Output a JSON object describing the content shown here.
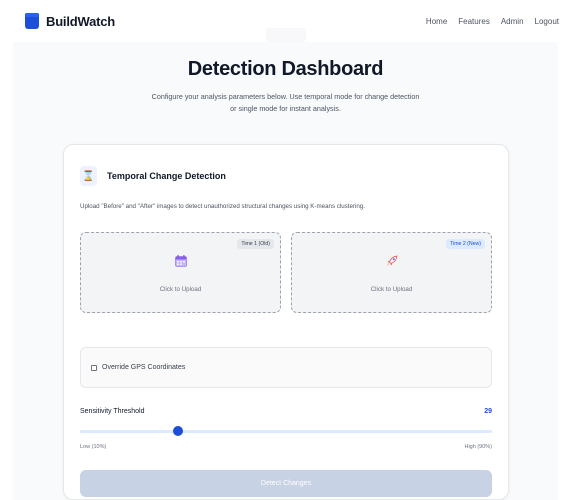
{
  "navbar": {
    "brand": "BuildWatch",
    "links": [
      "Home",
      "Features",
      "Admin",
      "Logout"
    ]
  },
  "hero": {
    "title": "Detection Dashboard",
    "subtitle": "Configure your analysis parameters below. Use temporal mode for change detection or single mode for instant analysis."
  },
  "card": {
    "title": "Temporal Change Detection",
    "description": "Upload \"Before\" and \"After\" images to detect unauthorized structural changes using K-means clustering.",
    "uploads": [
      {
        "tag": "Time 1 (Old)",
        "label": "Click to Upload",
        "icon": "calendar-icon"
      },
      {
        "tag": "Time 2 (New)",
        "label": "Click to Upload",
        "icon": "rocket-icon"
      }
    ],
    "gps": {
      "label": "Override GPS Coordinates",
      "checked": false
    },
    "sensitivity": {
      "label": "Sensitivity Threshold",
      "value": "29",
      "min_label": "Low (10%)",
      "max_label": "High (90%)",
      "min": 10,
      "max": 90,
      "current": 29
    },
    "button": "Detect Changes"
  },
  "colors": {
    "accent": "#1d4ed8",
    "button_disabled": "#c7d2e4",
    "page_bg": "#f9fafb"
  }
}
